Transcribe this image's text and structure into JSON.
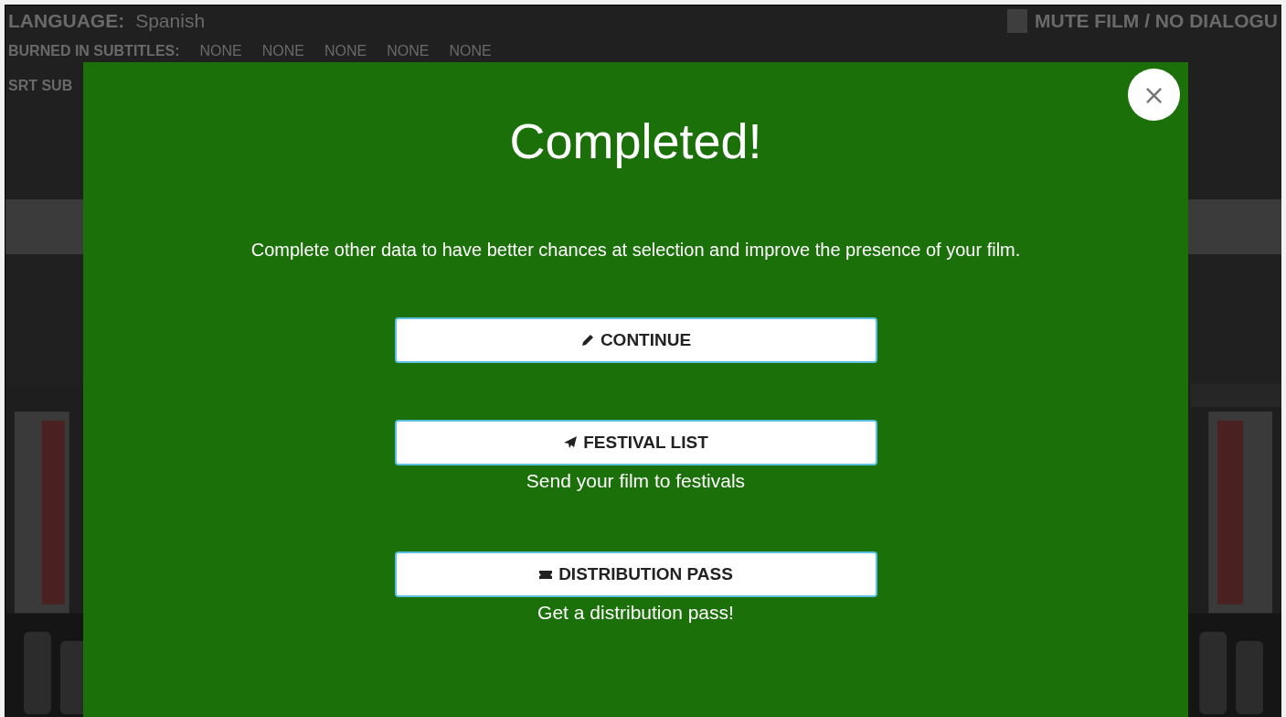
{
  "background": {
    "language_label": "LANGUAGE:",
    "language_value": "Spanish",
    "mute": {
      "label": "MUTE FILM / NO DIALOGU",
      "checked": false
    },
    "burned_label": "BURNED IN SUBTITLES:",
    "burned_values": [
      "NONE",
      "NONE",
      "NONE",
      "NONE",
      "NONE"
    ],
    "srt_label": "SRT SUB"
  },
  "modal": {
    "title": "Completed!",
    "close": "×",
    "message": "Complete other data to have better chances at selection and improve the presence of your film.",
    "actions": [
      {
        "kind": "pencil",
        "label": "CONTINUE"
      },
      {
        "kind": "plane",
        "label": "FESTIVAL LIST",
        "note": "Send your film to festivals"
      },
      {
        "kind": "ticket",
        "label": "DISTRIBUTION PASS",
        "note": "Get a distribution pass!"
      }
    ]
  }
}
